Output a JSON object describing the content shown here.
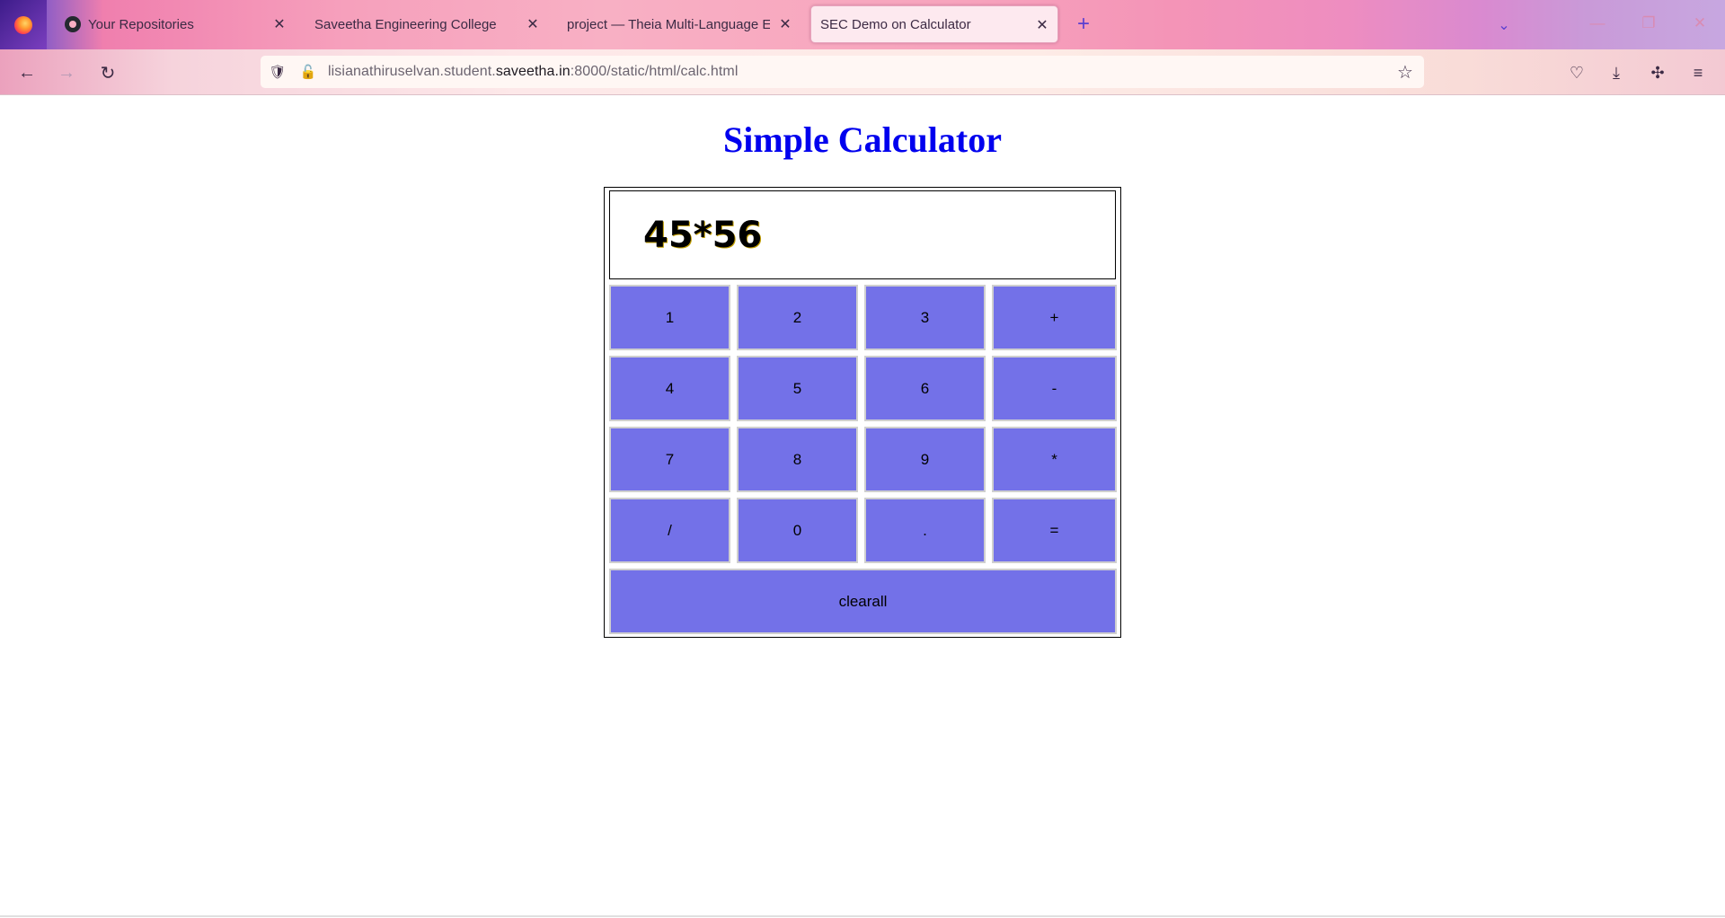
{
  "browser": {
    "tabs": [
      {
        "title": "Your Repositories",
        "icon": "github-icon",
        "active": false
      },
      {
        "title": "Saveetha Engineering College",
        "icon": "",
        "active": false
      },
      {
        "title": "project — Theia Multi-Language Ex",
        "icon": "",
        "active": false
      },
      {
        "title": "SEC Demo on Calculator",
        "icon": "",
        "active": true
      }
    ],
    "close_glyph": "✕",
    "url": {
      "prefix": "lisianathiruselvan.student.",
      "host": "saveetha.in",
      "suffix": ":8000/static/html/calc.html"
    }
  },
  "page": {
    "title": "Simple Calculator"
  },
  "calculator": {
    "display": "45*56",
    "keys": [
      "1",
      "2",
      "3",
      "+",
      "4",
      "5",
      "6",
      "-",
      "7",
      "8",
      "9",
      "*",
      "/",
      "0",
      ".",
      "="
    ],
    "clear_label": "clearall"
  },
  "colors": {
    "key_background": "#7371e8",
    "title": "#0000ee"
  }
}
